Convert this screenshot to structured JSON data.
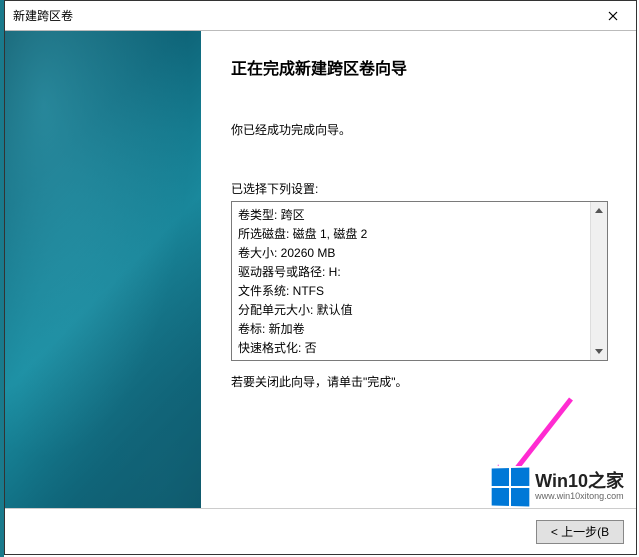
{
  "window": {
    "title": "新建跨区卷"
  },
  "wizard": {
    "heading": "正在完成新建跨区卷向导",
    "intro": "你已经成功完成向导。",
    "settings_label": "已选择下列设置:",
    "settings": [
      "卷类型: 跨区",
      "所选磁盘: 磁盘 1, 磁盘 2",
      "卷大小: 20260 MB",
      "驱动器号或路径: H:",
      "文件系统: NTFS",
      "分配单元大小: 默认值",
      "卷标: 新加卷",
      "快速格式化: 否"
    ],
    "closing_text": "若要关闭此向导，请单击\"完成\"。"
  },
  "buttons": {
    "back": "< 上一步(B"
  },
  "watermark": {
    "title": "Win10之家",
    "url": "www.win10xitong.com"
  }
}
